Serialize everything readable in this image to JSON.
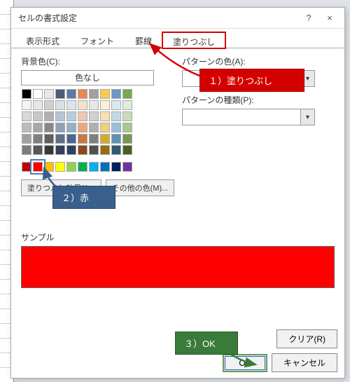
{
  "window": {
    "title": "セルの書式設定",
    "help_symbol": "?",
    "close_symbol": "×"
  },
  "tabs": {
    "t0": "表示形式",
    "t1": "フォント",
    "t2": "罫線",
    "t3": "塗りつぶし"
  },
  "left": {
    "bgcolor_label": "背景色(C):",
    "nocolor": "色なし",
    "effects_btn": "塗りつぶし効果(I)...",
    "other_btn": "その他の色(M)..."
  },
  "right": {
    "pattern_color_label": "パターンの色(A):",
    "pattern_style_label": "パターンの種類(P):"
  },
  "sample": {
    "label": "サンプル",
    "color": "#ff0000"
  },
  "footer": {
    "clear": "クリア(R)",
    "ok": "OK",
    "cancel": "キャンセル"
  },
  "callouts": {
    "c1": "１）塗りつぶし",
    "c2": "２）赤",
    "c3": "３）OK"
  },
  "palette_main": [
    [
      "#000000",
      "#ffffff",
      "#e8e8e8",
      "#4a5c7a",
      "#5a7aa8",
      "#e88850",
      "#a0a0a0",
      "#f8c850",
      "#6a98c8",
      "#78a850"
    ],
    [
      "#f4f4f4",
      "#e8e8e8",
      "#d0d0d0",
      "#dae0e8",
      "#dce4ee",
      "#f8e0d0",
      "#e8e8e8",
      "#fcf0d8",
      "#dce8f0",
      "#e0ecd8"
    ],
    [
      "#d8d8d8",
      "#c8c8c8",
      "#b0b0b0",
      "#b8c4d4",
      "#b8ccde",
      "#f0c8b0",
      "#d0d0d0",
      "#f8e0b0",
      "#c0d8e8",
      "#c8dcb8"
    ],
    [
      "#bcbcbc",
      "#a8a8a8",
      "#888888",
      "#8fa0b8",
      "#90b0cc",
      "#e8a880",
      "#b0b0b0",
      "#f0d080",
      "#98c0d8",
      "#a8c890"
    ],
    [
      "#a0a0a0",
      "#808080",
      "#606060",
      "#5c708c",
      "#486894",
      "#c87840",
      "#808080",
      "#d8a830",
      "#6090b8",
      "#789850"
    ],
    [
      "#7c7c7c",
      "#585858",
      "#383838",
      "#344058",
      "#2c4060",
      "#884820",
      "#505050",
      "#986c10",
      "#305878",
      "#486020"
    ]
  ],
  "palette_std": [
    [
      "#c00000",
      "#ff0000",
      "#ffc000",
      "#ffff00",
      "#92d050",
      "#00b050",
      "#00b0f0",
      "#0070c0",
      "#002060",
      "#7030a0"
    ]
  ],
  "selected_swatch": "#ff0000"
}
